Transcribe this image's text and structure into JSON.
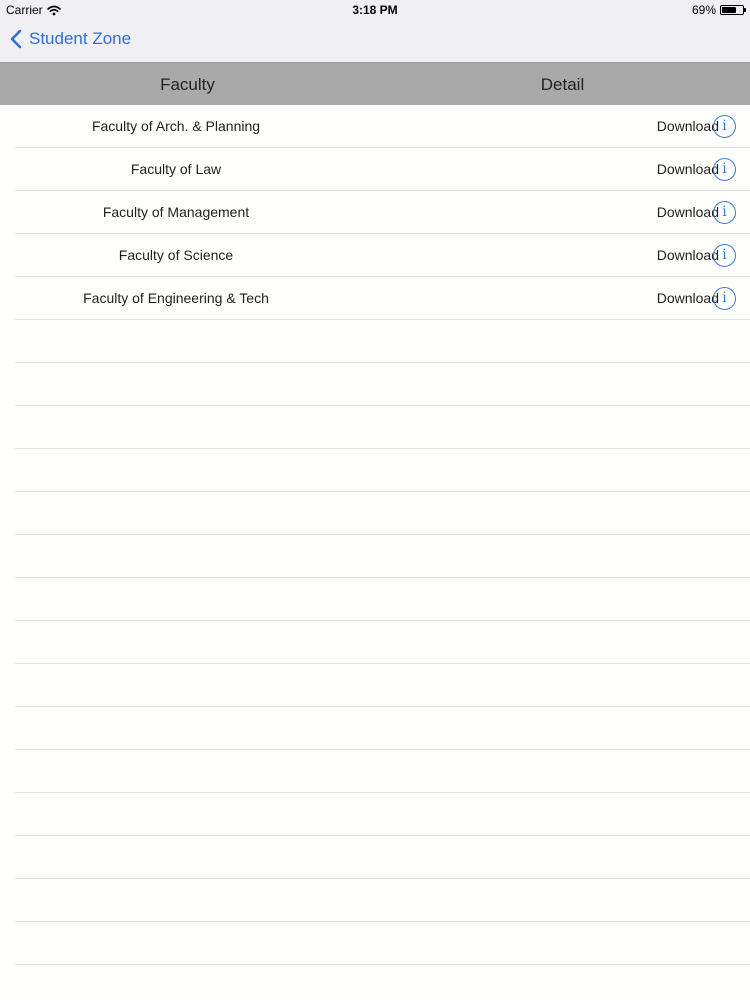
{
  "status_bar": {
    "carrier": "Carrier",
    "time": "3:18 PM",
    "battery_percent": "69%",
    "battery_level": 0.69
  },
  "nav": {
    "back_label": "Student Zone"
  },
  "table": {
    "headers": {
      "faculty": "Faculty",
      "detail": "Detail"
    },
    "rows": [
      {
        "name": "Faculty of Arch. & Planning",
        "action": "Download",
        "info_glyph": "i"
      },
      {
        "name": "Faculty of Law",
        "action": "Download",
        "info_glyph": "i"
      },
      {
        "name": "Faculty of Management",
        "action": "Download",
        "info_glyph": "i"
      },
      {
        "name": "Faculty of Science",
        "action": "Download",
        "info_glyph": "i"
      },
      {
        "name": "Faculty of Engineering & Tech",
        "action": "Download",
        "info_glyph": "i"
      }
    ]
  },
  "colors": {
    "accent": "#2f6fd6",
    "header_bg": "#a9a9a9",
    "bar_bg": "#efeff4"
  },
  "icons": {
    "wifi": "wifi-icon",
    "battery": "battery-icon",
    "back": "chevron-left-icon",
    "info": "info-icon"
  }
}
